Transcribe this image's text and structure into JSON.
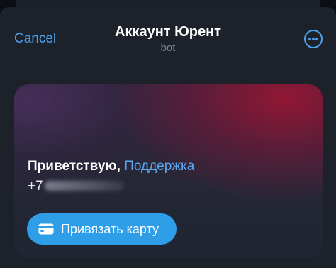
{
  "header": {
    "cancel_label": "Cancel",
    "title": "Аккаунт Юрент",
    "subtitle": "bot",
    "more_icon": "more-dots-icon"
  },
  "card": {
    "greeting": "Приветствую,",
    "support_name": "Поддержка",
    "phone_prefix": "+7",
    "phone_masked": true,
    "button": {
      "icon": "credit-card-icon",
      "label": "Привязать карту"
    }
  },
  "colors": {
    "accent": "#4aa2f0",
    "button_bg": "#2e9ee8",
    "sheet_bg": "#1d2129",
    "card_red": "#961634",
    "card_purple": "#48305c"
  }
}
